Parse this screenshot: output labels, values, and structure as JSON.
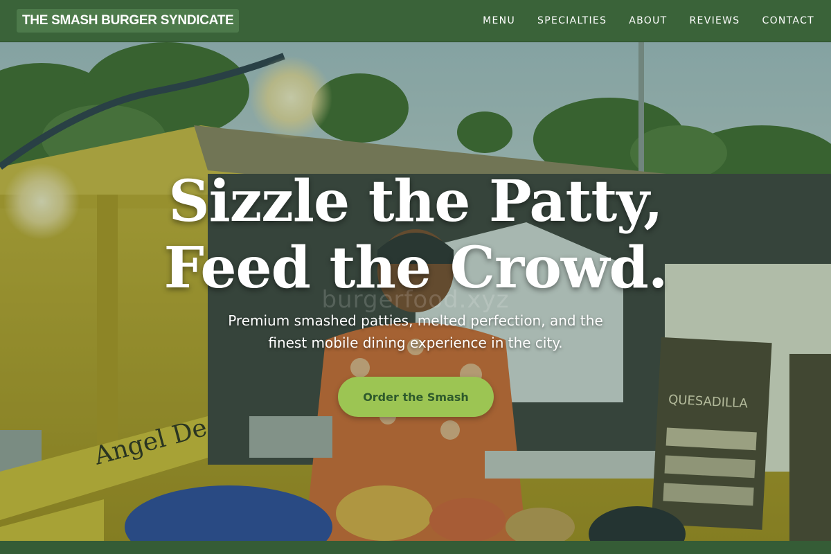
{
  "brand": {
    "name": "THE SMASH BURGER SYNDICATE"
  },
  "nav": {
    "items": [
      {
        "label": "MENU"
      },
      {
        "label": "SPECIALTIES"
      },
      {
        "label": "ABOUT"
      },
      {
        "label": "REVIEWS"
      },
      {
        "label": "CONTACT"
      }
    ]
  },
  "hero": {
    "title_line1": "Sizzle the Patty,",
    "title_line2": "Feed the Crowd.",
    "watermark": "burgerfood.xyz",
    "subtitle_line1": "Premium smashed patties, melted perfection, and the",
    "subtitle_line2": "finest mobile dining experience in the city.",
    "cta_label": "Order the Smash",
    "sign_text": "QUESADILLA",
    "tape_text": "Angel De"
  },
  "colors": {
    "nav_bg": "#3a6339",
    "brand_bg": "#4d7a4b",
    "cta_bg": "#9cc553",
    "cta_text": "#2e5a2c"
  }
}
